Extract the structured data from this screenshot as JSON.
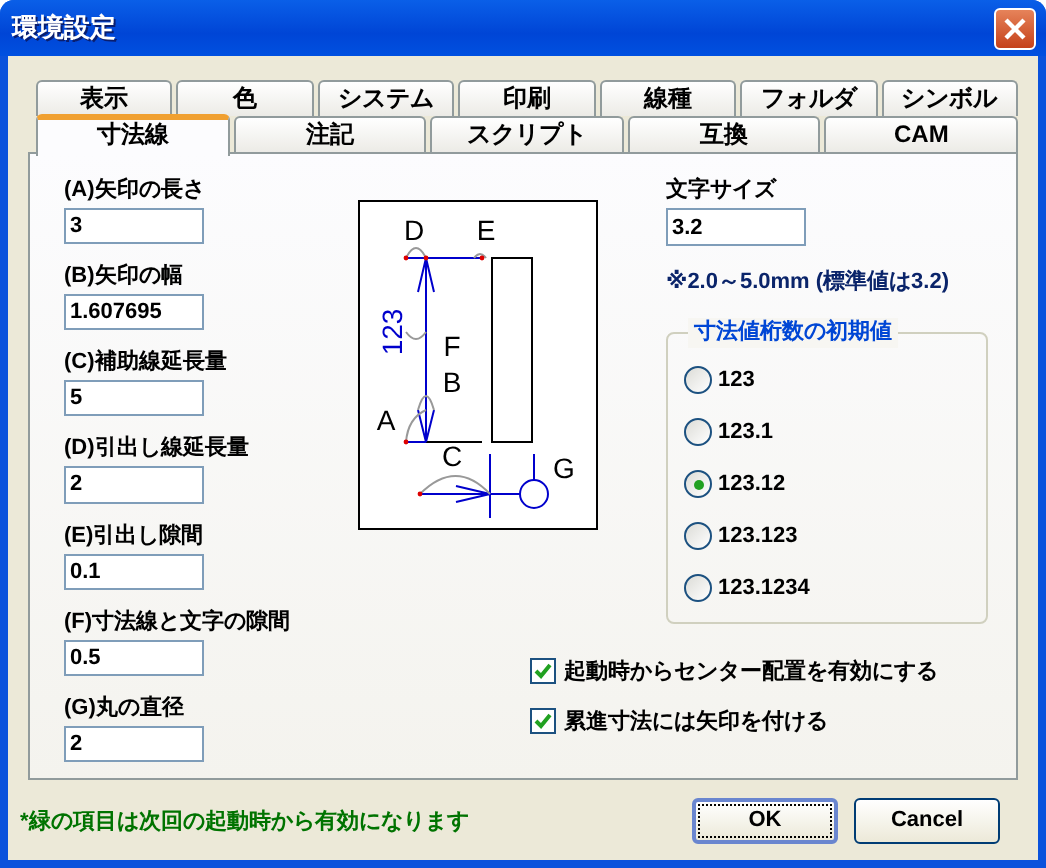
{
  "window": {
    "title": "環境設定"
  },
  "tab_rows": [
    [
      {
        "label": "表示",
        "selected": false
      },
      {
        "label": "色",
        "selected": false
      },
      {
        "label": "システム",
        "selected": false
      },
      {
        "label": "印刷",
        "selected": false
      },
      {
        "label": "線種",
        "selected": false
      },
      {
        "label": "フォルダ",
        "selected": false
      },
      {
        "label": "シンボル",
        "selected": false
      }
    ],
    [
      {
        "label": "寸法線",
        "selected": true
      },
      {
        "label": "注記",
        "selected": false
      },
      {
        "label": "スクリプト",
        "selected": false
      },
      {
        "label": "互換",
        "selected": false
      },
      {
        "label": "CAM",
        "selected": false
      }
    ]
  ],
  "fields": [
    {
      "label": "(A)矢印の長さ",
      "value": "3"
    },
    {
      "label": "(B)矢印の幅",
      "value": "1.607695"
    },
    {
      "label": "(C)補助線延長量",
      "value": "5"
    },
    {
      "label": "(D)引出し線延長量",
      "value": "2"
    },
    {
      "label": "(E)引出し隙間",
      "value": "0.1"
    },
    {
      "label": "(F)寸法線と文字の隙間",
      "value": "0.5"
    },
    {
      "label": "(G)丸の直径",
      "value": "2"
    }
  ],
  "diagram": {
    "labels": [
      "D",
      "E",
      "123",
      "F",
      "B",
      "A",
      "C",
      "G"
    ]
  },
  "text_size": {
    "label": "文字サイズ",
    "value": "3.2",
    "note": "※2.0～5.0mm (標準値は3.2)"
  },
  "digits_group": {
    "title": "寸法値桁数の初期値",
    "options": [
      {
        "label": "123",
        "selected": false
      },
      {
        "label": "123.1",
        "selected": false
      },
      {
        "label": "123.12",
        "selected": true
      },
      {
        "label": "123.123",
        "selected": false
      },
      {
        "label": "123.1234",
        "selected": false
      }
    ]
  },
  "checkboxes": [
    {
      "label": "起動時からセンター配置を有効にする",
      "checked": true
    },
    {
      "label": "累進寸法には矢印を付ける",
      "checked": true
    }
  ],
  "footer_note": "*緑の項目は次回の起動時から有効になります",
  "buttons": [
    {
      "label": "OK",
      "focused": true
    },
    {
      "label": "Cancel",
      "focused": false
    }
  ]
}
